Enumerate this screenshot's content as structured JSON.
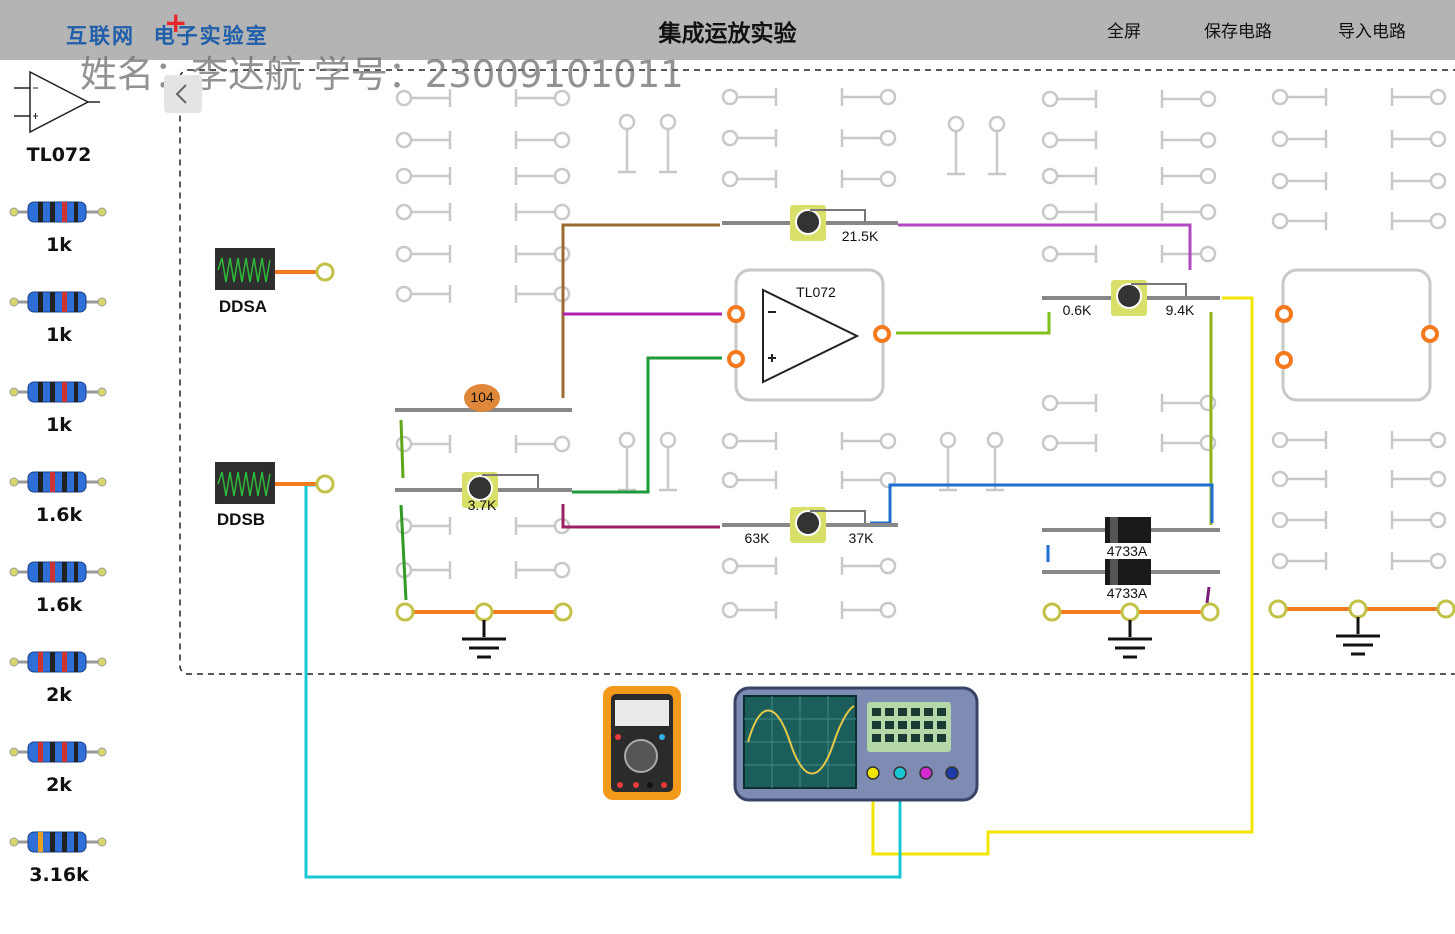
{
  "header": {
    "logo_text": "互联网",
    "logo_plus": "+",
    "logo_text2": "电子实验室",
    "title": "集成运放实验",
    "menu": [
      "全屏",
      "保存电路",
      "导入电路"
    ]
  },
  "watermark": "姓名：李达航 学号：23009101011",
  "palette": {
    "items": [
      {
        "label": "TL072",
        "icon": "opamp-icon"
      },
      {
        "label": "1k",
        "icon": "resistor-icon"
      },
      {
        "label": "1k",
        "icon": "resistor-icon"
      },
      {
        "label": "1k",
        "icon": "resistor-icon"
      },
      {
        "label": "1.6k",
        "icon": "resistor-icon"
      },
      {
        "label": "1.6k",
        "icon": "resistor-icon"
      },
      {
        "label": "2k",
        "icon": "resistor-icon"
      },
      {
        "label": "2k",
        "icon": "resistor-icon"
      },
      {
        "label": "3.16k",
        "icon": "resistor-icon"
      }
    ]
  },
  "board": {
    "sources": [
      {
        "label": "DDSA"
      },
      {
        "label": "DDSB"
      }
    ],
    "capacitor_label": "104",
    "opamp_label": "TL072",
    "pot_top": {
      "label": "21.5K"
    },
    "pot_right": {
      "left_label": "0.6K",
      "right_label": "9.4K"
    },
    "pot_left": {
      "label": "3.7K"
    },
    "pot_bottom": {
      "left_label": "63K",
      "right_label": "37K"
    },
    "diodes": [
      "4733A",
      "4733A"
    ]
  },
  "colors": {
    "topbar": "#b4b4b4",
    "wire_brown": "#9a6b2e",
    "wire_purple": "#b04ac0",
    "wire_green": "#1d9a3a",
    "wire_lime": "#8fb31c",
    "wire_blue": "#1e6fd0",
    "wire_cyan": "#19c7d4",
    "wire_yellow": "#f2e600",
    "terminal_orange": "#f47a20"
  }
}
